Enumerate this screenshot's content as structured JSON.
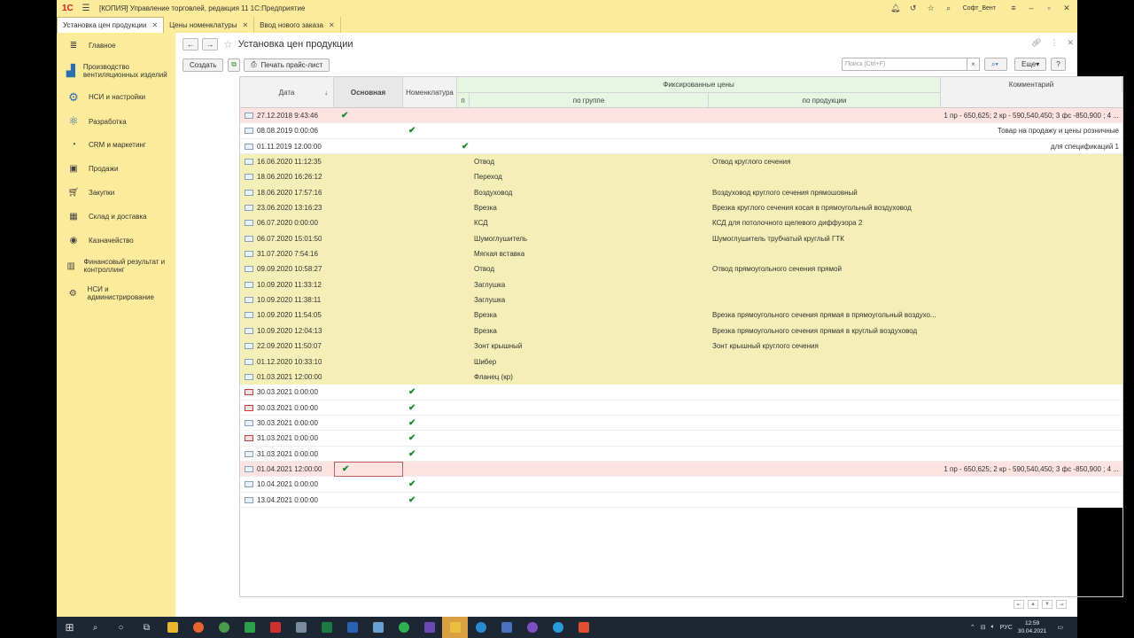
{
  "titlebar": {
    "logo": "1С",
    "title": "[КОПИЯ] Управление торговлей, редакция 11 1С:Предприятие",
    "user": "Софт_Вент"
  },
  "tabs": [
    {
      "label": "Установка цен продукции",
      "active": true
    },
    {
      "label": "Цены номенклатуры",
      "active": false
    },
    {
      "label": "Ввод нового заказа",
      "active": false
    }
  ],
  "sidebar": {
    "items": [
      {
        "label": "Главное",
        "icon": "menu-icon"
      },
      {
        "label": "Производство вентиляционных изделий",
        "icon": "factory-icon"
      },
      {
        "label": "НСИ и настройки",
        "icon": "gears-icon"
      },
      {
        "label": "Разработка",
        "icon": "development-icon"
      },
      {
        "label": "CRM и маркетинг",
        "icon": "crm-icon"
      },
      {
        "label": "Продажи",
        "icon": "bag-icon"
      },
      {
        "label": "Закупки",
        "icon": "cart-icon"
      },
      {
        "label": "Склад и доставка",
        "icon": "warehouse-icon"
      },
      {
        "label": "Казначейство",
        "icon": "coin-icon"
      },
      {
        "label": "Финансовый результат и контроллинг",
        "icon": "chart-icon"
      },
      {
        "label": "НСИ и администрирование",
        "icon": "gear-icon"
      }
    ]
  },
  "form": {
    "title": "Установка цен продукции",
    "create_label": "Создать",
    "print_label": "Печать прайс-лист",
    "search_placeholder": "Поиск (Ctrl+F)",
    "search_clear": "×",
    "more_label": "Еще",
    "help_label": "?"
  },
  "columns": {
    "date": "Дата",
    "sort_arrow": "↓",
    "main": "Основная",
    "nomenclature": "Номенклатура",
    "fixed": "Фиксированные цены",
    "p": "п",
    "by_group": "по группе",
    "by_product": "по продукции",
    "comment": "Комментарий"
  },
  "rows": [
    {
      "date": "27.12.2018 9:43:46",
      "style": "pink",
      "icon": "doc",
      "main": true,
      "nom": false,
      "p": false,
      "group": "",
      "product": "",
      "comment": "1 пр -  650,625; 2 кр - 590,540,450; 3 фс -850,900 ; 4 ..."
    },
    {
      "date": "08.08.2019 0:00:06",
      "style": "white",
      "icon": "doc",
      "main": false,
      "nom": true,
      "p": false,
      "group": "",
      "product": "",
      "comment": "Товар на продажу и цены розничные"
    },
    {
      "date": "01.11.2019 12:00:00",
      "style": "white",
      "icon": "doc",
      "main": false,
      "nom": false,
      "p": true,
      "group": "",
      "product": "",
      "comment": "для спецификаций 1"
    },
    {
      "date": "16.06.2020 11:12:35",
      "style": "yellow",
      "icon": "doc",
      "main": false,
      "nom": false,
      "p": false,
      "group": "Отвод",
      "product": "Отвод круглого сечения",
      "comment": ""
    },
    {
      "date": "18.06.2020 16:26:12",
      "style": "yellow",
      "icon": "doc-gray",
      "main": false,
      "nom": false,
      "p": false,
      "group": "Переход",
      "product": "",
      "comment": ""
    },
    {
      "date": "18.06.2020 17:57:16",
      "style": "yellow",
      "icon": "doc",
      "main": false,
      "nom": false,
      "p": false,
      "group": "Воздуховод",
      "product": "Воздуховод круглого сечения прямошовный",
      "comment": ""
    },
    {
      "date": "23.06.2020 13:16:23",
      "style": "yellow",
      "icon": "doc",
      "main": false,
      "nom": false,
      "p": false,
      "group": "Врезка",
      "product": "Врезка круглого сечения косая в прямоугольный воздуховод",
      "comment": ""
    },
    {
      "date": "06.07.2020 0:00:00",
      "style": "yellow",
      "icon": "doc",
      "main": false,
      "nom": false,
      "p": false,
      "group": "КСД",
      "product": "КСД для потолочного щелевого диффузора 2",
      "comment": ""
    },
    {
      "date": "06.07.2020 15:01:50",
      "style": "yellow",
      "icon": "doc",
      "main": false,
      "nom": false,
      "p": false,
      "group": "Шумоглушитель",
      "product": "Шумоглушитель трубчатый круглый ГТК",
      "comment": ""
    },
    {
      "date": "31.07.2020 7:54:16",
      "style": "yellow",
      "icon": "doc",
      "main": false,
      "nom": false,
      "p": false,
      "group": "Мягкая вставка",
      "product": "",
      "comment": ""
    },
    {
      "date": "09.09.2020 10:58:27",
      "style": "yellow",
      "icon": "doc",
      "main": false,
      "nom": false,
      "p": false,
      "group": "Отвод",
      "product": "Отвод прямоугольного сечения прямой",
      "comment": ""
    },
    {
      "date": "10.09.2020 11:33:12",
      "style": "yellow",
      "icon": "doc",
      "main": false,
      "nom": false,
      "p": false,
      "group": "Заглушка",
      "product": "",
      "comment": ""
    },
    {
      "date": "10.09.2020 11:38:11",
      "style": "yellow",
      "icon": "doc",
      "main": false,
      "nom": false,
      "p": false,
      "group": "Заглушка",
      "product": "",
      "comment": ""
    },
    {
      "date": "10.09.2020 11:54:05",
      "style": "yellow",
      "icon": "doc",
      "main": false,
      "nom": false,
      "p": false,
      "group": "Врезка",
      "product": "Врезка прямоугольного сечения прямая в прямоугольный воздухо...",
      "comment": ""
    },
    {
      "date": "10.09.2020 12:04:13",
      "style": "yellow",
      "icon": "doc",
      "main": false,
      "nom": false,
      "p": false,
      "group": "Врезка",
      "product": "Врезка прямоугольного сечения прямая в круглый воздуховод",
      "comment": ""
    },
    {
      "date": "22.09.2020 11:50:07",
      "style": "yellow",
      "icon": "doc",
      "main": false,
      "nom": false,
      "p": false,
      "group": "Зонт крышный",
      "product": "Зонт крышный круглого сечения",
      "comment": ""
    },
    {
      "date": "01.12.2020 10:33:10",
      "style": "yellow",
      "icon": "doc",
      "main": false,
      "nom": false,
      "p": false,
      "group": "Шибер",
      "product": "",
      "comment": ""
    },
    {
      "date": "01.03.2021 12:00:00",
      "style": "yellow",
      "icon": "doc",
      "main": false,
      "nom": false,
      "p": false,
      "group": "Фланец (кр)",
      "product": "",
      "comment": ""
    },
    {
      "date": "30.03.2021 0:00:00",
      "style": "white",
      "icon": "doc-red",
      "main": false,
      "nom": true,
      "p": false,
      "group": "",
      "product": "",
      "comment": ""
    },
    {
      "date": "30.03.2021 0:00:00",
      "style": "white",
      "icon": "doc-red",
      "main": false,
      "nom": true,
      "p": false,
      "group": "",
      "product": "",
      "comment": ""
    },
    {
      "date": "30.03.2021 0:00:00",
      "style": "white",
      "icon": "doc",
      "main": false,
      "nom": true,
      "p": false,
      "group": "",
      "product": "",
      "comment": ""
    },
    {
      "date": "31.03.2021 0:00:00",
      "style": "white",
      "icon": "doc-red",
      "main": false,
      "nom": true,
      "p": false,
      "group": "",
      "product": "",
      "comment": ""
    },
    {
      "date": "31.03.2021 0:00:00",
      "style": "white",
      "icon": "doc",
      "main": false,
      "nom": true,
      "p": false,
      "group": "",
      "product": "",
      "comment": ""
    },
    {
      "date": "01.04.2021 12:00:00",
      "style": "pink",
      "icon": "doc",
      "main": true,
      "main_selected": true,
      "nom": false,
      "p": false,
      "group": "",
      "product": "",
      "comment": "1 пр -  650,625; 2 кр - 590,540,450; 3 фс -850,900 ; 4 ..."
    },
    {
      "date": "10.04.2021 0:00:00",
      "style": "white",
      "icon": "doc",
      "main": false,
      "nom": true,
      "p": false,
      "group": "",
      "product": "",
      "comment": ""
    },
    {
      "date": "13.04.2021 0:00:00",
      "style": "white",
      "icon": "doc",
      "main": false,
      "nom": true,
      "p": false,
      "group": "",
      "product": "",
      "comment": ""
    }
  ],
  "taskbar": {
    "lang": "РУС",
    "time": "12:59",
    "date": "30.04.2021"
  },
  "colors": {
    "frame": "#fbeb9a",
    "row_pink": "#fde2e2",
    "row_yellow": "#f3efb6",
    "check": "#1b8a2e",
    "fixed_header": "#e6f6e2"
  }
}
